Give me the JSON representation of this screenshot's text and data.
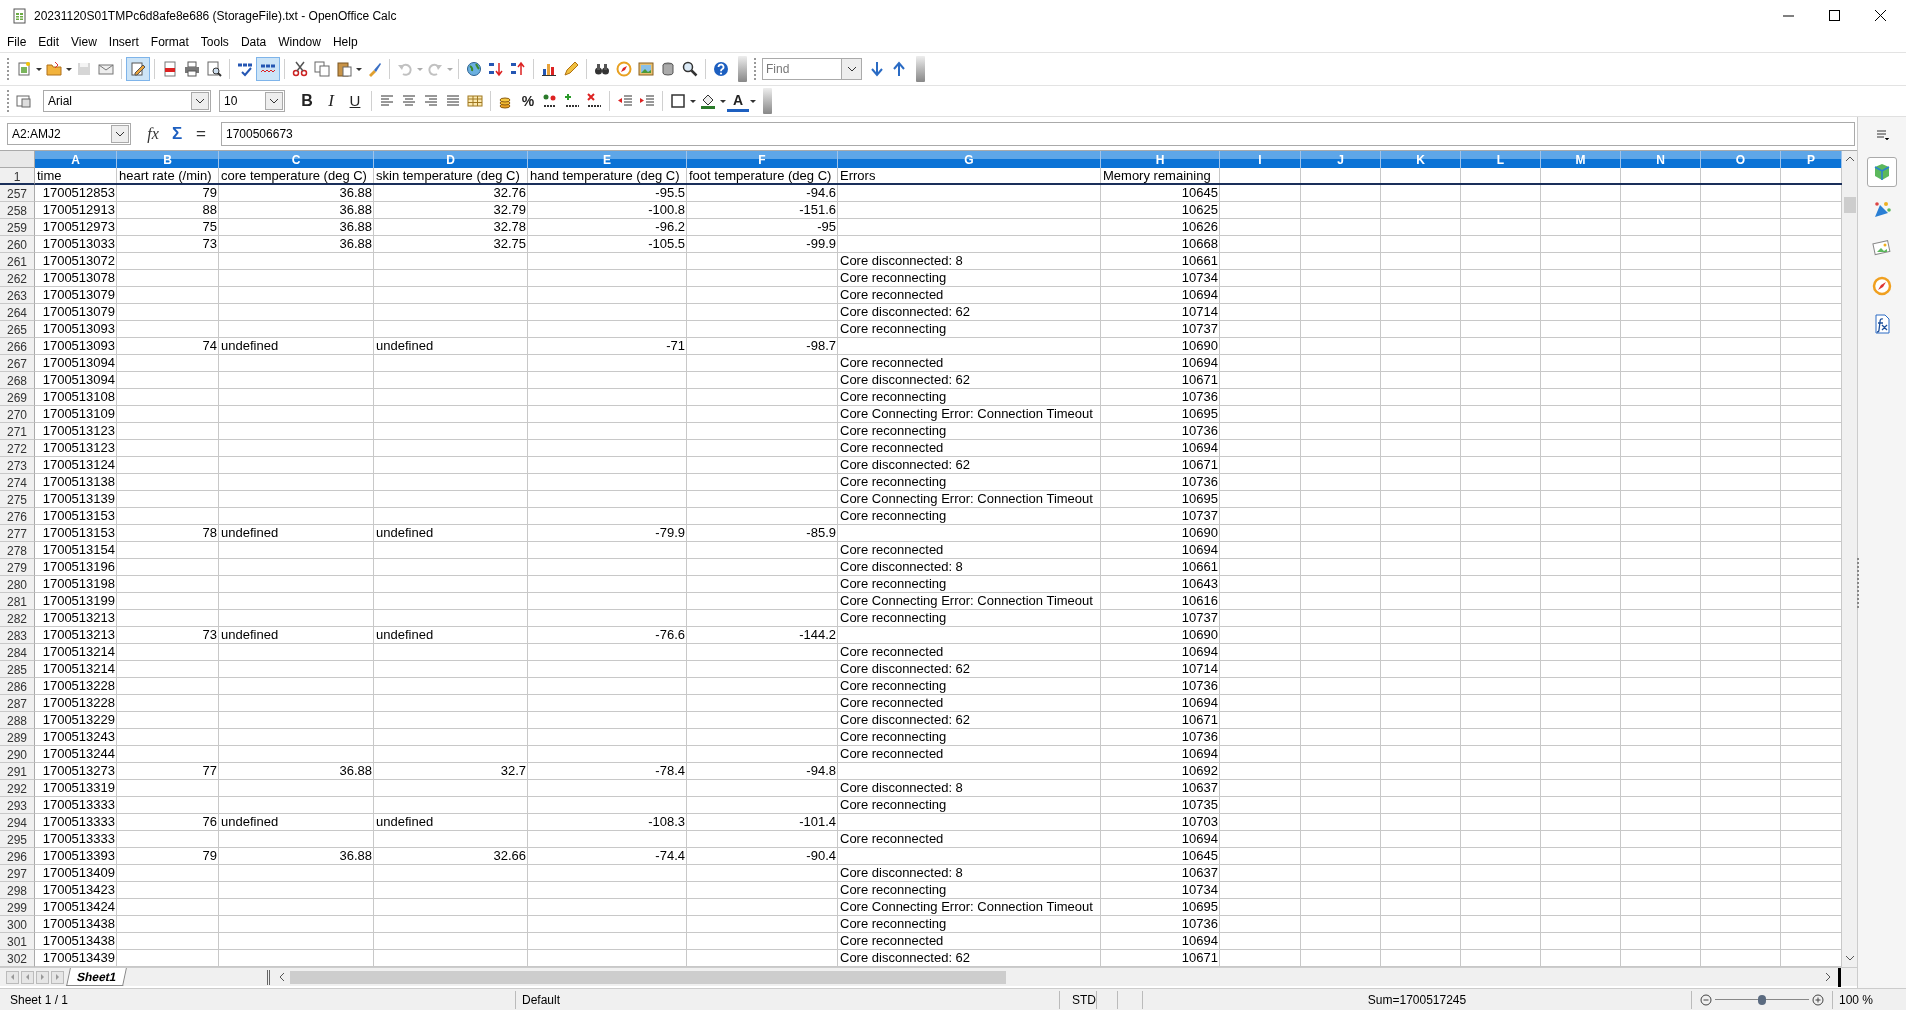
{
  "window": {
    "title": "20231120S01TMPc6d8afe8e686 (StorageFile).txt - OpenOffice Calc"
  },
  "menu": [
    "File",
    "Edit",
    "View",
    "Insert",
    "Format",
    "Tools",
    "Data",
    "Window",
    "Help"
  ],
  "standard_toolbar": {
    "edit_file": {
      "on": true
    },
    "auto_spellcheck": {
      "on": true
    },
    "undo": {
      "disabled": true
    },
    "redo": {
      "disabled": true
    },
    "find": {
      "placeholder": "Find"
    }
  },
  "formatting_toolbar": {
    "font_name": "Arial",
    "font_size": "10",
    "styles": [
      {
        "label": "B",
        "kind": "bold"
      },
      {
        "label": "I",
        "kind": "italic"
      },
      {
        "label": "U",
        "kind": "underline"
      }
    ],
    "percent": "%",
    "font_color": "A"
  },
  "formula_bar": {
    "name_box": "A2:AMJ2",
    "buttons": [
      {
        "label": "fx",
        "kind": "wizard"
      },
      {
        "label": "Σ",
        "kind": "sum"
      },
      {
        "label": "=",
        "kind": "function"
      }
    ],
    "input": "1700506673"
  },
  "sheet": {
    "columns": [
      {
        "label": "A",
        "selected": true
      },
      {
        "label": "B",
        "selected": true
      },
      {
        "label": "C",
        "selected": true
      },
      {
        "label": "D",
        "selected": true
      },
      {
        "label": "E",
        "selected": true
      },
      {
        "label": "F",
        "selected": true
      },
      {
        "label": "G",
        "selected": true
      },
      {
        "label": "H",
        "selected": true
      },
      {
        "label": "I",
        "selected": true
      },
      {
        "label": "J",
        "selected": true
      },
      {
        "label": "K",
        "selected": true
      },
      {
        "label": "L",
        "selected": true
      },
      {
        "label": "M",
        "selected": true
      },
      {
        "label": "N",
        "selected": true
      },
      {
        "label": "O",
        "selected": true
      },
      {
        "label": "P",
        "selected": true
      }
    ],
    "rows": [
      {
        "number": "1",
        "cells": {
          "A": "time",
          "B": "heart rate (/min)",
          "C": "core temperature (deg C)",
          "D": "skin temperature (deg C)",
          "E": "hand temperature (deg C)",
          "F": "foot temperature (deg C)",
          "G": "Errors",
          "H": "Memory remaining"
        }
      },
      {
        "number": "257",
        "cells": {
          "A": "1700512853",
          "B": "79",
          "C": "36.88",
          "D": "32.76",
          "E": "-95.5",
          "F": "-94.6",
          "H": "10645"
        }
      },
      {
        "number": "258",
        "cells": {
          "A": "1700512913",
          "B": "88",
          "C": "36.88",
          "D": "32.79",
          "E": "-100.8",
          "F": "-151.6",
          "H": "10625"
        }
      },
      {
        "number": "259",
        "cells": {
          "A": "1700512973",
          "B": "75",
          "C": "36.88",
          "D": "32.78",
          "E": "-96.2",
          "F": "-95",
          "H": "10626"
        }
      },
      {
        "number": "260",
        "cells": {
          "A": "1700513033",
          "B": "73",
          "C": "36.88",
          "D": "32.75",
          "E": "-105.5",
          "F": "-99.9",
          "H": "10668"
        }
      },
      {
        "number": "261",
        "cells": {
          "A": "1700513072",
          "G": "Core disconnected: 8",
          "H": "10661"
        }
      },
      {
        "number": "262",
        "cells": {
          "A": "1700513078",
          "G": "Core reconnecting",
          "H": "10734"
        }
      },
      {
        "number": "263",
        "cells": {
          "A": "1700513079",
          "G": "Core reconnected",
          "H": "10694"
        }
      },
      {
        "number": "264",
        "cells": {
          "A": "1700513079",
          "G": "Core disconnected: 62",
          "H": "10714"
        }
      },
      {
        "number": "265",
        "cells": {
          "A": "1700513093",
          "G": "Core reconnecting",
          "H": "10737"
        }
      },
      {
        "number": "266",
        "cells": {
          "A": "1700513093",
          "B": "74",
          "C": "undefined",
          "D": "undefined",
          "E": "-71",
          "F": "-98.7",
          "H": "10690"
        }
      },
      {
        "number": "267",
        "cells": {
          "A": "1700513094",
          "G": "Core reconnected",
          "H": "10694"
        }
      },
      {
        "number": "268",
        "cells": {
          "A": "1700513094",
          "G": "Core disconnected: 62",
          "H": "10671"
        }
      },
      {
        "number": "269",
        "cells": {
          "A": "1700513108",
          "G": "Core reconnecting",
          "H": "10736"
        }
      },
      {
        "number": "270",
        "cells": {
          "A": "1700513109",
          "G": "Core Connecting Error: Connection Timeout",
          "H": "10695"
        }
      },
      {
        "number": "271",
        "cells": {
          "A": "1700513123",
          "G": "Core reconnecting",
          "H": "10736"
        }
      },
      {
        "number": "272",
        "cells": {
          "A": "1700513123",
          "G": "Core reconnected",
          "H": "10694"
        }
      },
      {
        "number": "273",
        "cells": {
          "A": "1700513124",
          "G": "Core disconnected: 62",
          "H": "10671"
        }
      },
      {
        "number": "274",
        "cells": {
          "A": "1700513138",
          "G": "Core reconnecting",
          "H": "10736"
        }
      },
      {
        "number": "275",
        "cells": {
          "A": "1700513139",
          "G": "Core Connecting Error: Connection Timeout",
          "H": "10695"
        }
      },
      {
        "number": "276",
        "cells": {
          "A": "1700513153",
          "G": "Core reconnecting",
          "H": "10737"
        }
      },
      {
        "number": "277",
        "cells": {
          "A": "1700513153",
          "B": "78",
          "C": "undefined",
          "D": "undefined",
          "E": "-79.9",
          "F": "-85.9",
          "H": "10690"
        }
      },
      {
        "number": "278",
        "cells": {
          "A": "1700513154",
          "G": "Core reconnected",
          "H": "10694"
        }
      },
      {
        "number": "279",
        "cells": {
          "A": "1700513196",
          "G": "Core disconnected: 8",
          "H": "10661"
        }
      },
      {
        "number": "280",
        "cells": {
          "A": "1700513198",
          "G": "Core reconnecting",
          "H": "10643"
        }
      },
      {
        "number": "281",
        "cells": {
          "A": "1700513199",
          "G": "Core Connecting Error: Connection Timeout",
          "H": "10616"
        }
      },
      {
        "number": "282",
        "cells": {
          "A": "1700513213",
          "G": "Core reconnecting",
          "H": "10737"
        }
      },
      {
        "number": "283",
        "cells": {
          "A": "1700513213",
          "B": "73",
          "C": "undefined",
          "D": "undefined",
          "E": "-76.6",
          "F": "-144.2",
          "H": "10690"
        }
      },
      {
        "number": "284",
        "cells": {
          "A": "1700513214",
          "G": "Core reconnected",
          "H": "10694"
        }
      },
      {
        "number": "285",
        "cells": {
          "A": "1700513214",
          "G": "Core disconnected: 62",
          "H": "10714"
        }
      },
      {
        "number": "286",
        "cells": {
          "A": "1700513228",
          "G": "Core reconnecting",
          "H": "10736"
        }
      },
      {
        "number": "287",
        "cells": {
          "A": "1700513228",
          "G": "Core reconnected",
          "H": "10694"
        }
      },
      {
        "number": "288",
        "cells": {
          "A": "1700513229",
          "G": "Core disconnected: 62",
          "H": "10671"
        }
      },
      {
        "number": "289",
        "cells": {
          "A": "1700513243",
          "G": "Core reconnecting",
          "H": "10736"
        }
      },
      {
        "number": "290",
        "cells": {
          "A": "1700513244",
          "G": "Core reconnected",
          "H": "10694"
        }
      },
      {
        "number": "291",
        "cells": {
          "A": "1700513273",
          "B": "77",
          "C": "36.88",
          "D": "32.7",
          "E": "-78.4",
          "F": "-94.8",
          "H": "10692"
        }
      },
      {
        "number": "292",
        "cells": {
          "A": "1700513319",
          "G": "Core disconnected: 8",
          "H": "10637"
        }
      },
      {
        "number": "293",
        "cells": {
          "A": "1700513333",
          "G": "Core reconnecting",
          "H": "10735"
        }
      },
      {
        "number": "294",
        "cells": {
          "A": "1700513333",
          "B": "76",
          "C": "undefined",
          "D": "undefined",
          "E": "-108.3",
          "F": "-101.4",
          "H": "10703"
        }
      },
      {
        "number": "295",
        "cells": {
          "A": "1700513333",
          "G": "Core reconnected",
          "H": "10694"
        }
      },
      {
        "number": "296",
        "cells": {
          "A": "1700513393",
          "B": "79",
          "C": "36.88",
          "D": "32.66",
          "E": "-74.4",
          "F": "-90.4",
          "H": "10645"
        }
      },
      {
        "number": "297",
        "cells": {
          "A": "1700513409",
          "G": "Core disconnected: 8",
          "H": "10637"
        }
      },
      {
        "number": "298",
        "cells": {
          "A": "1700513423",
          "G": "Core reconnecting",
          "H": "10734"
        }
      },
      {
        "number": "299",
        "cells": {
          "A": "1700513424",
          "G": "Core Connecting Error: Connection Timeout",
          "H": "10695"
        }
      },
      {
        "number": "300",
        "cells": {
          "A": "1700513438",
          "G": "Core reconnecting",
          "H": "10736"
        }
      },
      {
        "number": "301",
        "cells": {
          "A": "1700513438",
          "G": "Core reconnected",
          "H": "10694"
        }
      },
      {
        "number": "302",
        "cells": {
          "A": "1700513439",
          "G": "Core disconnected: 62",
          "H": "10671"
        }
      }
    ]
  },
  "sheet_tabs": [
    {
      "label": "Sheet1",
      "selected": true
    }
  ],
  "status_bar": {
    "sheet": "Sheet 1 / 1",
    "page_style": "Default",
    "mode": "STD",
    "sum": "Sum=1700517245",
    "zoom": {
      "level": 0.5,
      "reading": "100 %"
    }
  }
}
